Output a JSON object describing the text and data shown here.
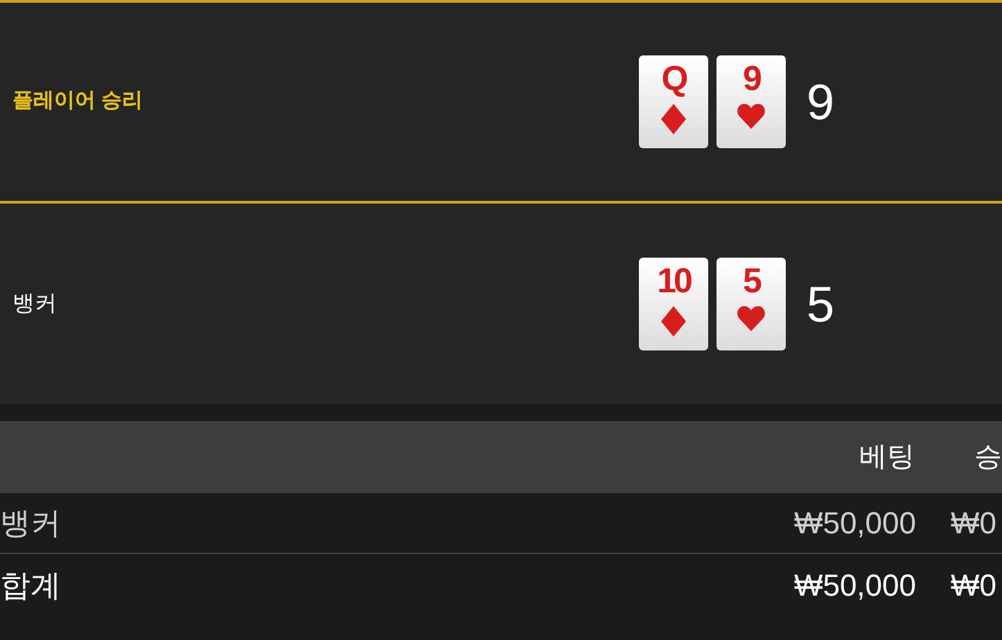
{
  "hands": [
    {
      "label": "플레이어 승리",
      "winner": true,
      "cards": [
        {
          "rank": "Q",
          "kind": "diamond"
        },
        {
          "rank": "9",
          "kind": "heart"
        }
      ],
      "score": "9"
    },
    {
      "label": "뱅커",
      "winner": false,
      "cards": [
        {
          "rank": "10",
          "kind": "diamond"
        },
        {
          "rank": "5",
          "kind": "heart"
        }
      ],
      "score": "5"
    }
  ],
  "bets_table": {
    "columns": [
      "베팅",
      "승"
    ],
    "rows": [
      {
        "kind": "bet",
        "label": "뱅커",
        "bet": "₩50,000",
        "win": "₩0"
      },
      {
        "kind": "total",
        "label": "합계",
        "bet": "₩50,000",
        "win": "₩0"
      }
    ]
  }
}
